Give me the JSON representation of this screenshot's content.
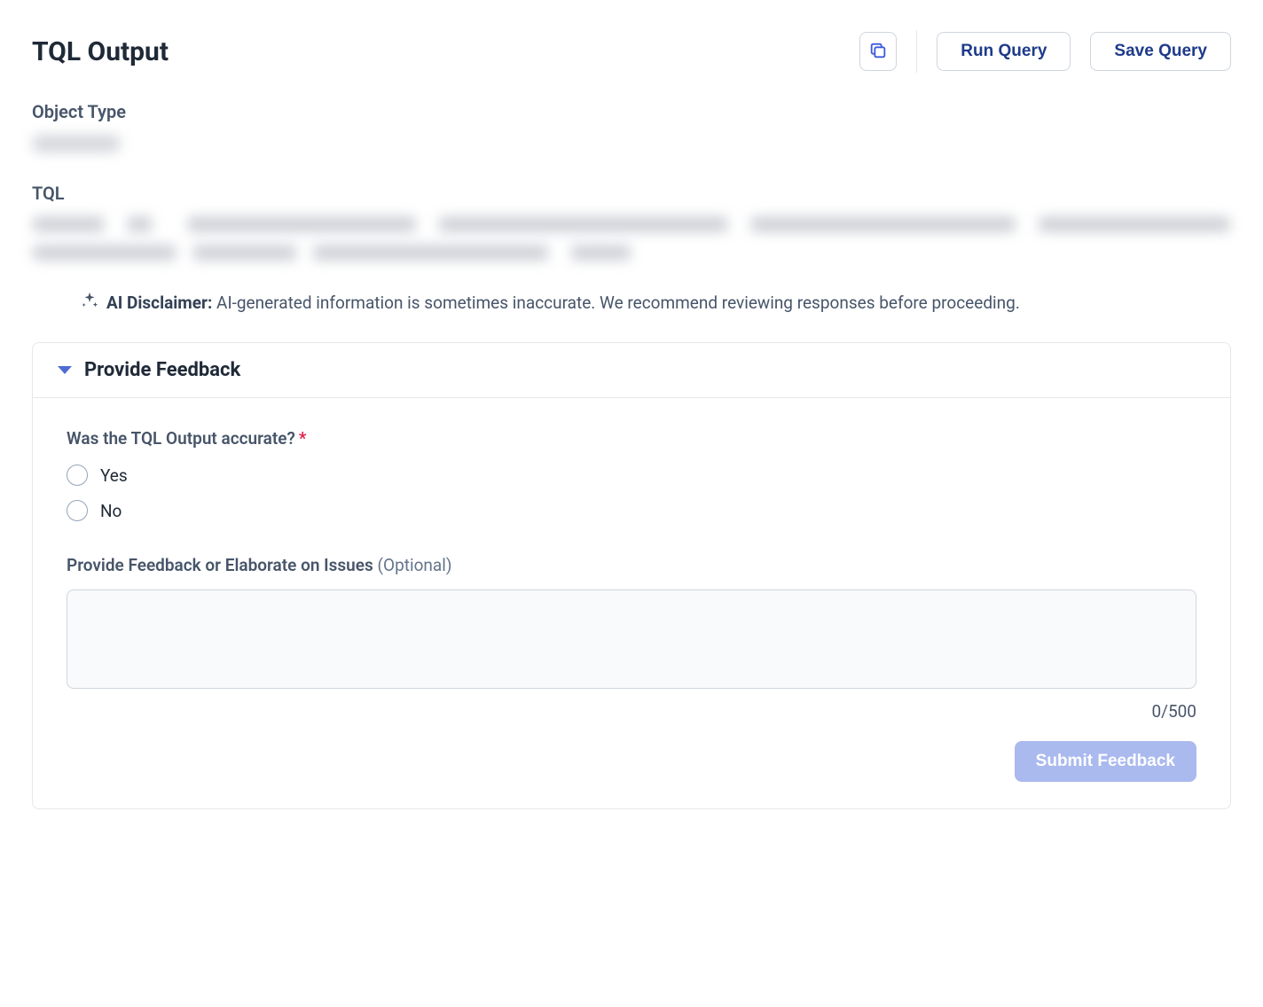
{
  "header": {
    "title": "TQL Output",
    "run_query_label": "Run Query",
    "save_query_label": "Save Query"
  },
  "sections": {
    "object_type_label": "Object Type",
    "tql_label": "TQL"
  },
  "disclaimer": {
    "prefix": "AI Disclaimer:",
    "text": " AI-generated information is sometimes inaccurate. We recommend reviewing responses before proceeding."
  },
  "feedback": {
    "panel_title": "Provide Feedback",
    "question": "Was the TQL Output accurate?",
    "required_mark": "*",
    "option_yes": "Yes",
    "option_no": "No",
    "elaborate_label": "Provide Feedback or Elaborate on Issues",
    "optional_label": "(Optional)",
    "char_count": "0/500",
    "submit_label": "Submit Feedback",
    "textarea_value": ""
  }
}
